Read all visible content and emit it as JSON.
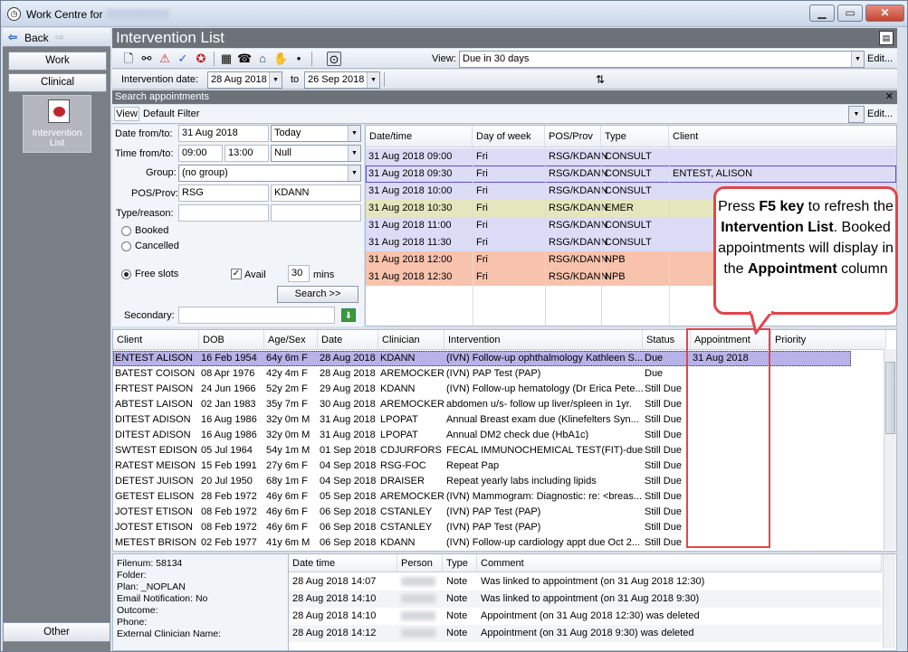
{
  "window": {
    "title": "Work Centre for",
    "btn_min": "▁",
    "btn_max": "▭",
    "btn_close": "✕"
  },
  "nav": {
    "back": "Back",
    "work": "Work",
    "clinical": "Clinical",
    "tile_line1": "Intervention",
    "tile_line2": "List",
    "other": "Other"
  },
  "header": {
    "title": "Intervention List"
  },
  "toolbar": {
    "view_label": "View:",
    "view_value": "Due in 30 days",
    "edit": "Edit..."
  },
  "daterow": {
    "label": "Intervention date:",
    "from": "28 Aug 2018",
    "to_label": "to",
    "to": "26 Sep 2018"
  },
  "search": {
    "title": "Search appointments",
    "close": "✕",
    "view_label": "View",
    "filter": "Default Filter",
    "edit": "Edit..."
  },
  "form": {
    "date_label": "Date from/to:",
    "date_value": "31 Aug 2018",
    "date_preset": "Today",
    "time_label": "Time from/to:",
    "time_from": "09:00",
    "time_to": "13:00",
    "time_preset": "Null",
    "group_label": "Group:",
    "group_value": "(no group)",
    "posprov_label": "POS/Prov:",
    "pos": "RSG",
    "prov": "KDANN",
    "type_label": "Type/reason:",
    "booked": "Booked",
    "cancelled": "Cancelled",
    "free": "Free slots",
    "avail": "Avail",
    "mins_value": "30",
    "mins": "mins",
    "search_btn": "Search >>",
    "secondary_label": "Secondary:"
  },
  "appt_grid": {
    "columns": [
      "Date/time",
      "Day of week",
      "POS/Prov",
      "Type",
      "Client"
    ],
    "rows": [
      {
        "dt": "31 Aug 2018 09:00",
        "dow": "Fri",
        "pp": "RSG/KDANN",
        "type": "CONSULT",
        "client": "",
        "color": "#dcdcf7"
      },
      {
        "dt": "31 Aug 2018 09:30",
        "dow": "Fri",
        "pp": "RSG/KDANN",
        "type": "CONSULT",
        "client": "ENTEST, ALISON",
        "color": "#dcdcf7"
      },
      {
        "dt": "31 Aug 2018 10:00",
        "dow": "Fri",
        "pp": "RSG/KDANN",
        "type": "CONSULT",
        "client": "",
        "color": "#dcdcf7"
      },
      {
        "dt": "31 Aug 2018 10:30",
        "dow": "Fri",
        "pp": "RSG/KDANN",
        "type": "EMER",
        "client": "",
        "color": "#e6e6bd"
      },
      {
        "dt": "31 Aug 2018 11:00",
        "dow": "Fri",
        "pp": "RSG/KDANN",
        "type": "CONSULT",
        "client": "",
        "color": "#dcdcf7"
      },
      {
        "dt": "31 Aug 2018 11:30",
        "dow": "Fri",
        "pp": "RSG/KDANN",
        "type": "CONSULT",
        "client": "",
        "color": "#dcdcf7"
      },
      {
        "dt": "31 Aug 2018 12:00",
        "dow": "Fri",
        "pp": "RSG/KDANN",
        "type": "NPB",
        "client": "",
        "color": "#f8c3ad"
      },
      {
        "dt": "31 Aug 2018 12:30",
        "dow": "Fri",
        "pp": "RSG/KDANN",
        "type": "NPB",
        "client": "",
        "color": "#f8c3ad"
      }
    ]
  },
  "main_grid": {
    "columns": [
      "Client",
      "DOB",
      "Age/Sex",
      "Date",
      "Clinician",
      "Intervention",
      "Status",
      "Appointment",
      "Priority"
    ],
    "rows": [
      [
        "ENTEST ALISON",
        "16 Feb 1954",
        "64y 6m F",
        "28 Aug 2018",
        "KDANN",
        "(IVN) Follow-up ophthalmology Kathleen S...",
        "Due",
        "31 Aug 2018",
        ""
      ],
      [
        "BATEST COISON",
        "08 Apr 1976",
        "42y 4m F",
        "28 Aug 2018",
        "AREMOCKER",
        "(IVN) PAP Test (PAP)",
        "Due",
        "",
        ""
      ],
      [
        "FRTEST PAISON",
        "24 Jun 1966",
        "52y 2m F",
        "29 Aug 2018",
        "KDANN",
        "(IVN) Follow-up hematology (Dr Erica Pete...",
        "Still Due",
        "",
        ""
      ],
      [
        "ABTEST LAISON",
        "02 Jan 1983",
        "35y 7m F",
        "30 Aug 2018",
        "AREMOCKER",
        "abdomen u/s- follow up liver/spleen in 1yr.",
        "Still Due",
        "",
        ""
      ],
      [
        "DITEST ADISON",
        "16 Aug 1986",
        "32y 0m M",
        "31 Aug 2018",
        "LPOPAT",
        "Annual Breast exam due (Klinefelters Syn...",
        "Still Due",
        "",
        ""
      ],
      [
        "DITEST ADISON",
        "16 Aug 1986",
        "32y 0m M",
        "31 Aug 2018",
        "LPOPAT",
        "Annual DM2 check due (HbA1c)",
        "Still Due",
        "",
        ""
      ],
      [
        "SWTEST EDISON",
        "05 Jul 1964",
        "54y 1m M",
        "01 Sep 2018",
        "CDJURFORS",
        "FECAL IMMUNOCHEMICAL TEST(FIT)-due ...",
        "Still Due",
        "",
        ""
      ],
      [
        "RATEST MEISON",
        "15 Feb 1991",
        "27y 6m F",
        "04 Sep 2018",
        "RSG-FOC",
        "Repeat Pap",
        "Still Due",
        "",
        ""
      ],
      [
        "DETEST JUISON",
        "20 Jul 1950",
        "68y 1m F",
        "04 Sep 2018",
        "DRAISER",
        "Repeat yearly labs including lipids",
        "Still Due",
        "",
        ""
      ],
      [
        "GETEST ELISON",
        "28 Feb 1972",
        "46y 6m F",
        "05 Sep 2018",
        "AREMOCKER",
        "(IVN) Mammogram: Diagnostic: re: <breas...",
        "Still Due",
        "",
        ""
      ],
      [
        "JOTEST ETISON",
        "08 Feb 1972",
        "46y 6m F",
        "06 Sep 2018",
        "CSTANLEY",
        "(IVN) PAP Test (PAP)",
        "Still Due",
        "",
        ""
      ],
      [
        "JOTEST ETISON",
        "08 Feb 1972",
        "46y 6m F",
        "06 Sep 2018",
        "CSTANLEY",
        "(IVN) PAP Test (PAP)",
        "Still Due",
        "",
        ""
      ],
      [
        "METEST BRISON",
        "02 Feb 1977",
        "41y 6m M",
        "06 Sep 2018",
        "KDANN",
        "(IVN) Follow-up cardiology appt due Oct 2...",
        "Still Due",
        "",
        ""
      ]
    ]
  },
  "info": {
    "filenum": "Filenum: 58134",
    "folder": "Folder:",
    "plan": "Plan: _NOPLAN",
    "email": "Email Notification: No",
    "outcome": "Outcome:",
    "phone": "Phone:",
    "ext": "External Clinician Name:"
  },
  "history": {
    "columns": [
      "Date time",
      "Person",
      "Type",
      "Comment"
    ],
    "rows": [
      [
        "28 Aug 2018 14:07",
        "Note",
        "Was linked to appointment (on 31 Aug 2018 12:30)"
      ],
      [
        "28 Aug 2018 14:10",
        "Note",
        "Was linked to appointment (on 31 Aug 2018 9:30)"
      ],
      [
        "28 Aug 2018 14:10",
        "Note",
        "Appointment (on 31 Aug 2018 12:30) was deleted"
      ],
      [
        "28 Aug 2018 14:12",
        "Note",
        "Appointment (on 31 Aug 2018 9:30) was deleted"
      ]
    ]
  },
  "callout": {
    "t1": "Press ",
    "b1": "F5 key",
    "t2": " to refresh the ",
    "b2": "Intervention List",
    "t3": ". Booked appointments will display in the ",
    "b3": "Appointment",
    "t4": " column"
  }
}
